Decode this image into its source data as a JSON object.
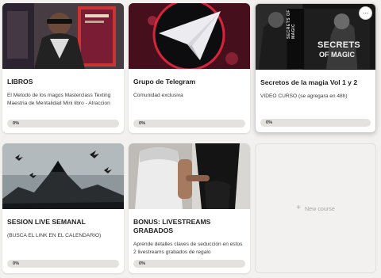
{
  "courses": [
    {
      "title": "LIBROS",
      "description": "El Metodo de los magos Masterclass Texting Maestria de Mentalidad Mini libro - Atraccion",
      "progress_label": "0%",
      "progress": 0,
      "thumbnail_icon": "books-cover-image"
    },
    {
      "title": "Grupo de Telegram",
      "description": "Comunidad exclusiva",
      "progress_label": "0%",
      "progress": 0,
      "thumbnail_icon": "telegram-logo-image"
    },
    {
      "title": "Secretos de la magia Vol 1 y 2",
      "description": "VIDEO CURSO (se agregara en 48h)",
      "progress_label": "0%",
      "progress": 0,
      "thumbnail_icon": "secrets-of-magic-cover-image",
      "thumbnail_text": {
        "spine": "SECRETS OF MAGIC",
        "cover_line1": "SECRETS",
        "cover_line2": "OF MAGIC"
      },
      "menu_label": "···"
    },
    {
      "title": "SESION LIVE SEMANAL",
      "description": "(BUSCA EL LINK EN EL CALENDARIO)",
      "progress_label": "0%",
      "progress": 0,
      "thumbnail_icon": "dark-mountain-image"
    },
    {
      "title": "BONUS: LIVESTREAMS GRABADOS",
      "description": "Aprende detalles claves de seducción en estos 2 livestreams grabados de regalo",
      "progress_label": "0%",
      "progress": 0,
      "thumbnail_icon": "couple-photo-image"
    }
  ],
  "new_course": {
    "label": "New course",
    "icon": "plus-icon"
  },
  "colors": {
    "background": "#f2f1ef",
    "card": "#ffffff",
    "progress_track": "#e3e2df",
    "accent": "#2d8cff"
  }
}
